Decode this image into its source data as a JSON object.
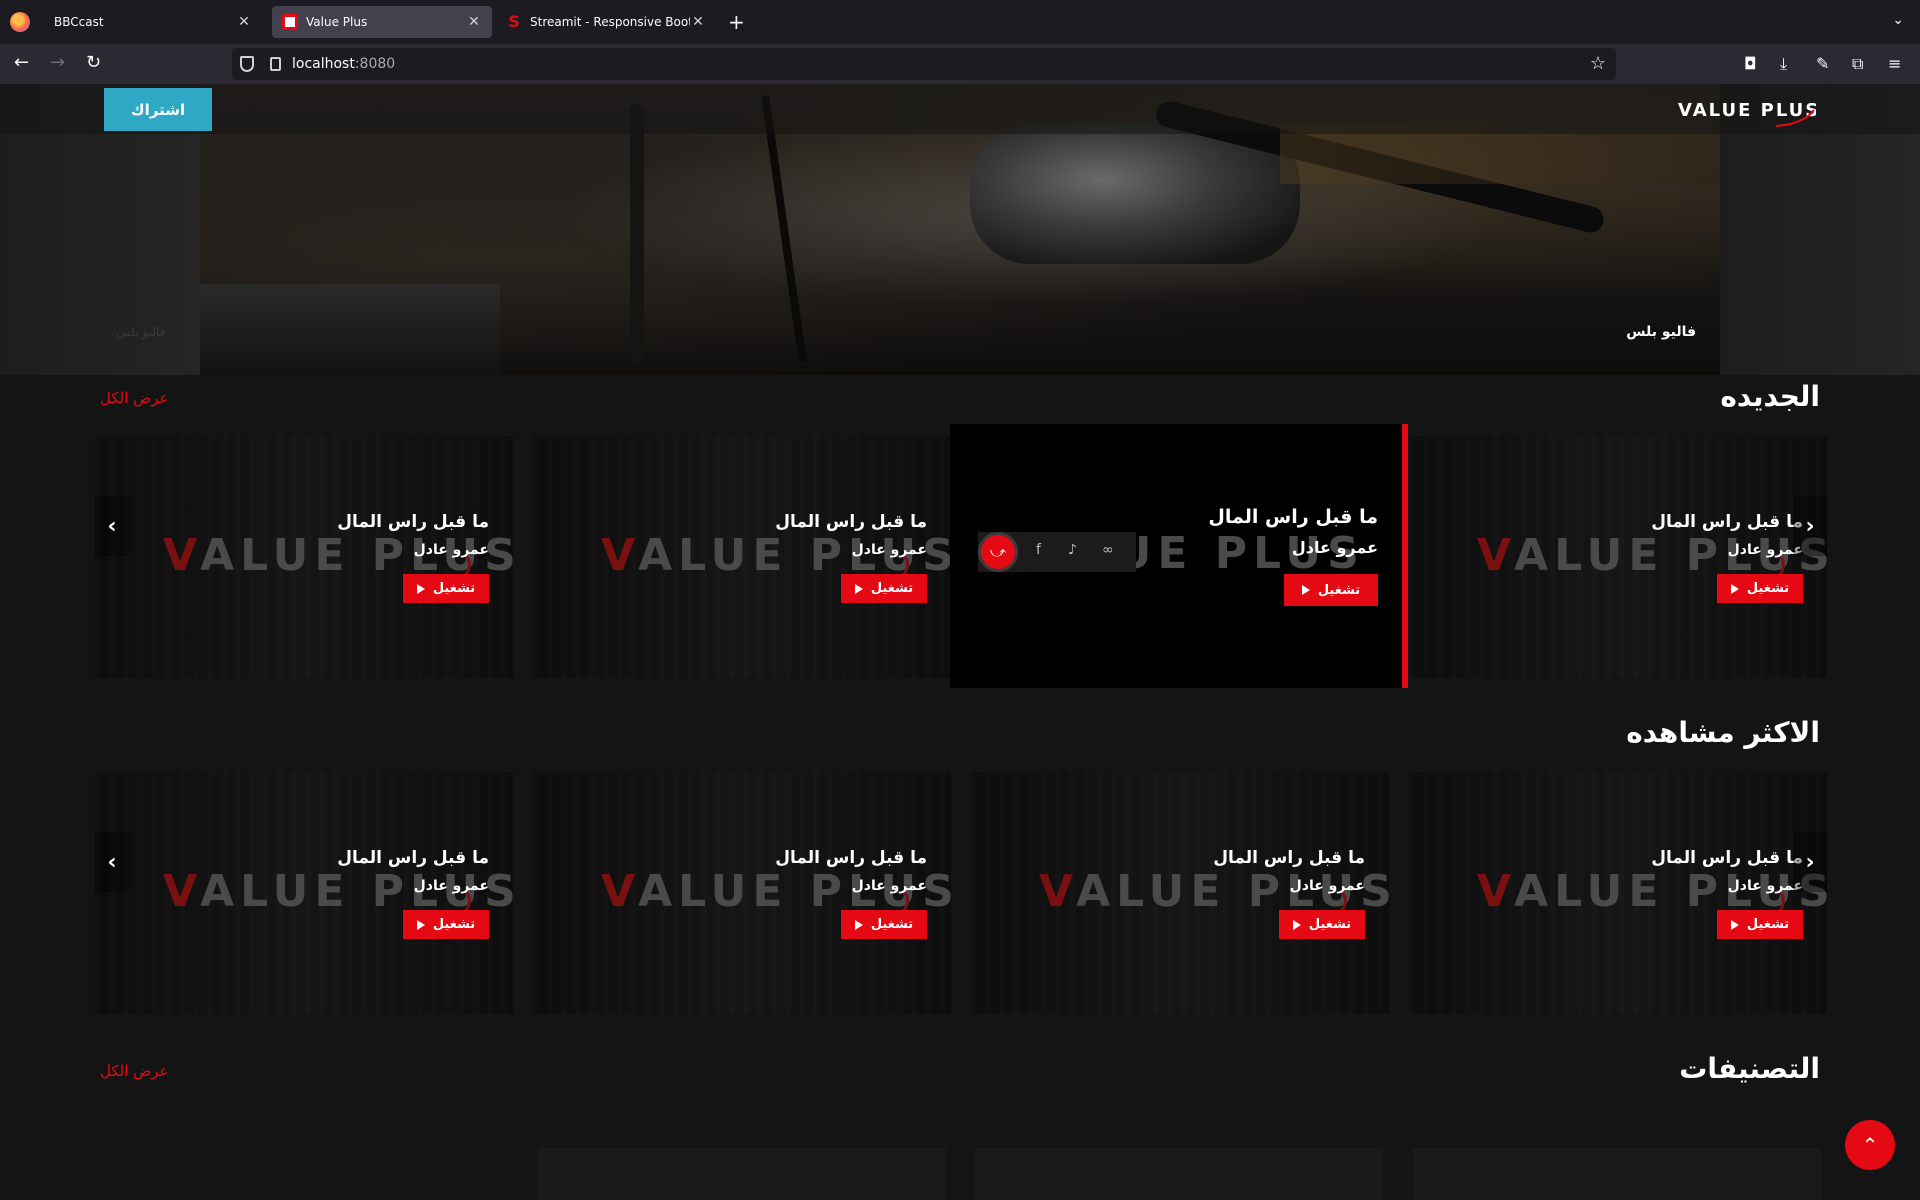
{
  "browser": {
    "tabs": [
      {
        "title": "BBCcast",
        "close": "✕"
      },
      {
        "title": "Value Plus",
        "close": "✕"
      },
      {
        "title": "Streamit - Responsive Bootstrap",
        "close": "✕"
      }
    ],
    "new_tab": "+",
    "tab_list": "⌄",
    "url_host": "localhost",
    "url_port": ":8080",
    "back": "←",
    "forward": "→",
    "reload": "↻",
    "bookmark": "☆"
  },
  "header": {
    "subscribe_label": "اشتراك",
    "logo_text": "VALUE PLUS"
  },
  "hero": {
    "caption": "فاليو بلس",
    "ghost_caption": "فاليو بلس"
  },
  "sections": {
    "new": {
      "title": "الجديده",
      "view_all": "عرض الكل"
    },
    "most_watched": {
      "title": "الاكثر مشاهده"
    },
    "categories": {
      "title": "التصنيفات",
      "view_all": "عرض الكل"
    }
  },
  "cards": {
    "logo_v": "V",
    "logo_rest": "ALUE PLUS",
    "title": "ما قبل راس المال",
    "subtitle": "عمرو عادل",
    "play_label": "تشغيل"
  },
  "share": {
    "main_icon": "share-icon",
    "icons": [
      "facebook-icon",
      "twitter-icon",
      "link-icon"
    ]
  },
  "arrows": {
    "prev": "‹",
    "next": "›"
  },
  "to_top": "⌃"
}
